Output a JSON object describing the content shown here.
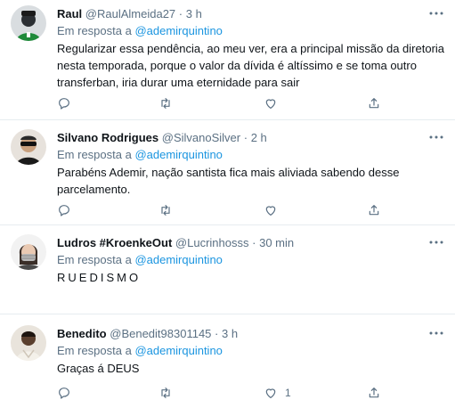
{
  "tweets": [
    {
      "name": "Raul",
      "handle": "@RaulAlmeida27",
      "separator": "·",
      "time": "3 h",
      "reply_prefix": "Em resposta a ",
      "reply_to": "@ademirquintino",
      "text": "Regularizar essa pendência, ao meu ver, era a principal missão da diretoria\nnesta temporada, porque o valor da dívida é altíssimo e se toma outro\ntransferban, iria durar uma eternidade para sair",
      "like_count": ""
    },
    {
      "name": "Silvano Rodrigues",
      "handle": "@SilvanoSilver",
      "separator": "·",
      "time": "2 h",
      "reply_prefix": "Em resposta a ",
      "reply_to": "@ademirquintino",
      "text": "Parabéns Ademir,  nação santista fica mais aliviada sabendo desse\nparcelamento.",
      "like_count": ""
    },
    {
      "name": "Ludros #KroenkeOut",
      "handle": "@Lucrinhosss",
      "separator": "·",
      "time": "30 min",
      "reply_prefix": "Em resposta a ",
      "reply_to": "@ademirquintino",
      "text": "RUEDISMO",
      "like_count": ""
    },
    {
      "name": "Benedito",
      "handle": "@Benedit98301145",
      "separator": "·",
      "time": "3 h",
      "reply_prefix": "Em resposta a ",
      "reply_to": "@ademirquintino",
      "text": "Graças á DEUS",
      "like_count": "1"
    }
  ],
  "icons": {
    "more": "more-options-icon",
    "reply": "reply-icon",
    "retweet": "retweet-icon",
    "like": "like-icon",
    "share": "share-icon"
  },
  "colors": {
    "text": "#0f1419",
    "secondary": "#5b7083",
    "mention": "#1b95e0",
    "divider": "#e6ecf0"
  }
}
